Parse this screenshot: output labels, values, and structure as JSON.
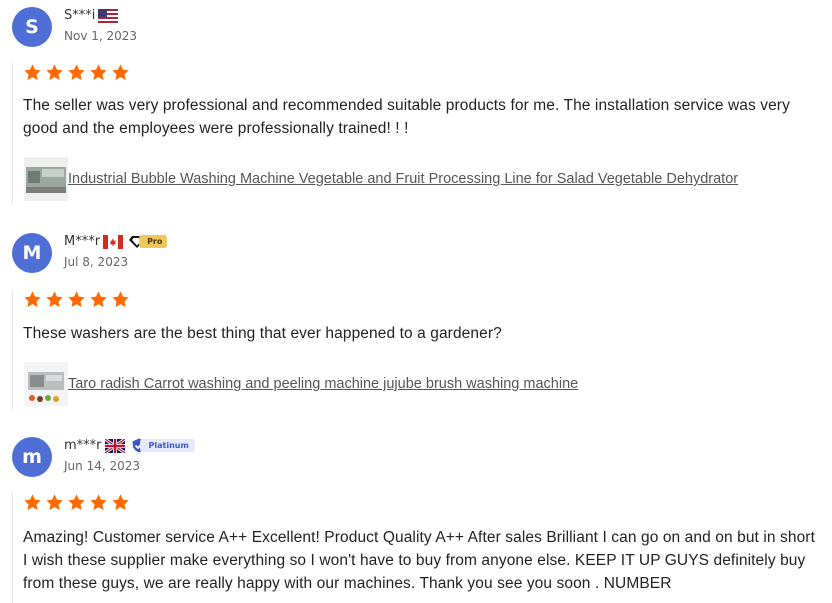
{
  "reviews": [
    {
      "avatar_letter": "S",
      "name": "S***i",
      "country_flag": "us-flag-icon",
      "badge": "",
      "date": "Nov 1, 2023",
      "rating": 5,
      "text": "The seller was very professional and recommended suitable products for me. The installation service was very good and the employees were professionally trained! ! !",
      "product_link": "Industrial Bubble Washing Machine Vegetable and Fruit Processing Line for Salad Vegetable Dehydrator"
    },
    {
      "avatar_letter": "M",
      "name": "M***r",
      "country_flag": "canada-flag-icon",
      "badge": "Pro",
      "date": "Jul 8, 2023",
      "rating": 5,
      "text": "These washers are the best thing that ever happened to a gardener?",
      "product_link": "Taro radish Carrot washing and peeling machine jujube brush washing machine"
    },
    {
      "avatar_letter": "m",
      "name": "m***r",
      "country_flag": "uk-flag-icon",
      "badge": "Platinum",
      "date": "Jun 14, 2023",
      "rating": 5,
      "text": "Amazing! Customer service A++ Excellent! Product Quality A++ After sales Brilliant I can go on and on but in short I wish these supplier make everything so I won't have to buy from anyone else. KEEP IT UP GUYS definitely buy from these guys, we are really happy with our machines. Thank you see you soon . NUMBER",
      "product_link": ""
    }
  ],
  "colors": {
    "avatar": "#4f6fd6",
    "star": "#ff6a00"
  }
}
